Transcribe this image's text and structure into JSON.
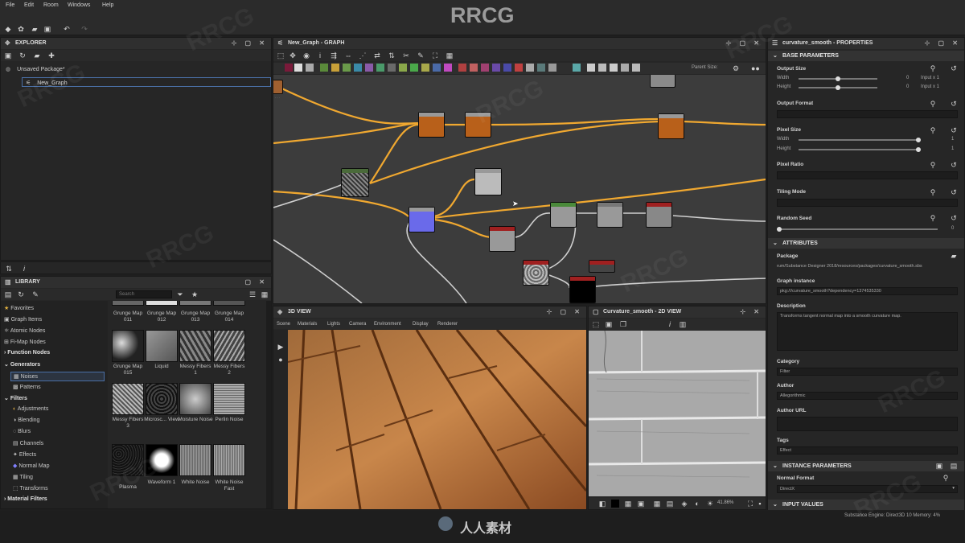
{
  "menu": [
    "File",
    "Edit",
    "Room",
    "Windows",
    "Help"
  ],
  "brand": "RRCG",
  "explorer": {
    "title": "EXPLORER",
    "package": "Unsaved Package*",
    "graph": "New_Graph"
  },
  "graph": {
    "title": "New_Graph - GRAPH",
    "parent_size_label": "Parent Size:"
  },
  "library": {
    "title": "LIBRARY",
    "search_placeholder": "Search",
    "categories": [
      {
        "label": "Favorites",
        "bold": false
      },
      {
        "label": "Graph Items",
        "bold": false
      },
      {
        "label": "Atomic Nodes",
        "bold": false
      },
      {
        "label": "Fi-Map Nodes",
        "bold": false
      },
      {
        "label": "Function Nodes",
        "bold": true
      },
      {
        "label": "Generators",
        "bold": true
      },
      {
        "label": "Noises",
        "bold": false
      },
      {
        "label": "Patterns",
        "bold": false
      },
      {
        "label": "Filters",
        "bold": true
      },
      {
        "label": "Adjustments",
        "bold": false
      },
      {
        "label": "Blending",
        "bold": false
      },
      {
        "label": "Blurs",
        "bold": false
      },
      {
        "label": "Channels",
        "bold": false
      },
      {
        "label": "Effects",
        "bold": false
      },
      {
        "label": "Normal Map",
        "bold": false
      },
      {
        "label": "Tiling",
        "bold": false
      },
      {
        "label": "Transforms",
        "bold": false
      },
      {
        "label": "Material Filters",
        "bold": true
      }
    ],
    "thumbs": [
      "Grunge Map 011",
      "Grunge Map 012",
      "Grunge Map 013",
      "Grunge Map 014",
      "Grunge Map 015",
      "Liquid",
      "Messy Fibers 1",
      "Messy Fibers 2",
      "Messy Fibers 3",
      "Microsc... View",
      "Moisture Noise",
      "Perlin Noise",
      "Plasma",
      "Waveform 1",
      "White Noise",
      "White Noise Fast"
    ]
  },
  "view3d": {
    "title": "3D VIEW",
    "menu": [
      "Scene",
      "Materials",
      "Lights",
      "Camera",
      "Environment",
      "Display",
      "Renderer"
    ]
  },
  "view2d": {
    "title": "Curvature_smooth - 2D VIEW",
    "zoom": "41.86%"
  },
  "properties": {
    "title": "curvature_smooth - PROPERTIES",
    "base_parameters": "BASE PARAMETERS",
    "output_size": "Output Size",
    "width": "Width",
    "height": "Height",
    "input_x1": "Input x 1",
    "zero": "0",
    "output_format": "Output Format",
    "pixel_size": "Pixel Size",
    "one": "1",
    "pixel_ratio": "Pixel Ratio",
    "tiling_mode": "Tiling Mode",
    "random_seed": "Random Seed",
    "attributes": "ATTRIBUTES",
    "package_label": "Package",
    "package_value": "rum/Substance Designer 2018/resources/packages/curvature_smooth.sbs",
    "graph_instance_label": "Graph instance",
    "graph_instance_value": "pkg:///curvature_smooth?dependency=1374535330",
    "description_label": "Description",
    "description_value": "Transforms tangent normal map into a smooth curvature map.",
    "category_label": "Category",
    "category_value": "Filter",
    "author_label": "Author",
    "author_value": "Allegorithmic",
    "author_url_label": "Author URL",
    "tags_label": "Tags",
    "tags_value": "Effect",
    "instance_parameters": "INSTANCE PARAMETERS",
    "normal_format_label": "Normal Format",
    "normal_format_value": "DirectX",
    "input_values": "INPUT VALUES"
  },
  "status": {
    "engine": "Substance Engine: Direct3D 10   Memory: 4%"
  },
  "footer_brand": "人人素材"
}
